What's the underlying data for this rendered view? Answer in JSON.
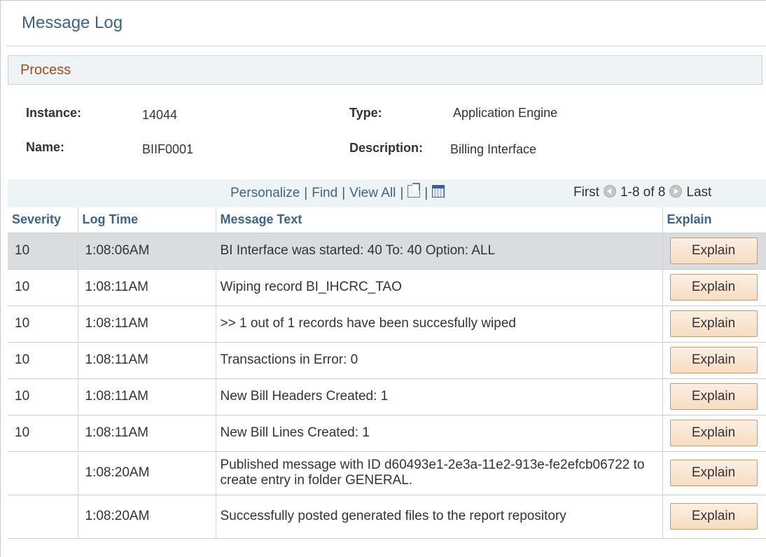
{
  "page": {
    "title": "Message Log"
  },
  "process": {
    "header": "Process",
    "instance_label": "Instance:",
    "instance_value": "14044",
    "name_label": "Name:",
    "name_value": "BIIF0001",
    "type_label": "Type:",
    "type_value": "Application Engine",
    "description_label": "Description:",
    "description_value": "Billing Interface"
  },
  "grid_nav": {
    "personalize": "Personalize",
    "find": "Find",
    "view_all": "View All",
    "separator": "|",
    "first": "First",
    "range": "1-8 of 8",
    "last": "Last",
    "zoom_icon": "new-window-icon",
    "download_icon": "spreadsheet-download-icon"
  },
  "table": {
    "columns": [
      "Severity",
      "Log Time",
      "Message Text",
      "Explain"
    ],
    "rows": [
      {
        "severity": "10",
        "time": "1:08:06AM",
        "message": "BI Interface was started: 40 To: 40  Option: ALL",
        "button": "Explain"
      },
      {
        "severity": "10",
        "time": "1:08:11AM",
        "message": "Wiping record BI_IHCRC_TAO",
        "button": "Explain"
      },
      {
        "severity": "10",
        "time": "1:08:11AM",
        "message": ">> 1 out of 1 records have been succesfully wiped",
        "button": "Explain"
      },
      {
        "severity": "10",
        "time": "1:08:11AM",
        "message": "Transactions in Error: 0",
        "button": "Explain"
      },
      {
        "severity": "10",
        "time": "1:08:11AM",
        "message": "New Bill Headers Created:  1",
        "button": "Explain"
      },
      {
        "severity": "10",
        "time": "1:08:11AM",
        "message": "New Bill Lines Created: 1",
        "button": "Explain"
      },
      {
        "severity": "",
        "time": "1:08:20AM",
        "message": "Published message with ID d60493e1-2e3a-11e2-913e-fe2efcb06722 to create entry in folder GENERAL.",
        "button": "Explain"
      },
      {
        "severity": "",
        "time": "1:08:20AM",
        "message": "Successfully posted generated files to the report repository",
        "button": "Explain"
      }
    ]
  }
}
